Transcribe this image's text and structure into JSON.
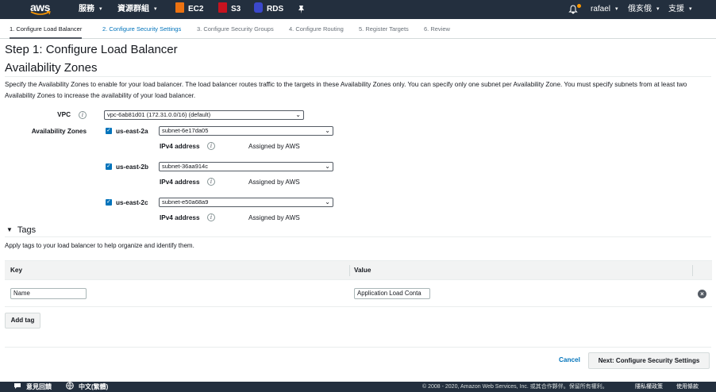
{
  "topnav": {
    "logo_text": "aws",
    "services": "服務",
    "resource_groups": "資源群組",
    "ec2": "EC2",
    "s3": "S3",
    "rds": "RDS",
    "user": "rafael",
    "region": "俄亥俄",
    "support": "支援",
    "caret": "▾",
    "colors": {
      "ec2": "#ec7211",
      "s3": "#c7131f",
      "rds": "#3b48cc",
      "accent": "#ff9900"
    }
  },
  "wizard": {
    "steps": [
      "1. Configure Load Balancer",
      "2. Configure Security Settings",
      "3. Configure Security Groups",
      "4. Configure Routing",
      "5. Register Targets",
      "6. Review"
    ]
  },
  "page": {
    "title": "Step 1: Configure Load Balancer",
    "section": "Availability Zones",
    "description": "Specify the Availability Zones to enable for your load balancer. The load balancer routes traffic to the targets in these Availability Zones only. You can specify only one subnet per Availability Zone. You must specify subnets from at least two Availability Zones to increase the availability of your load balancer."
  },
  "vpc": {
    "label": "VPC",
    "value": "vpc-6ab81d01 (172.31.0.0/16) (default)"
  },
  "az": {
    "label": "Availability Zones",
    "ipv4_label": "IPv4 address",
    "assigned": "Assigned by AWS",
    "zones": [
      {
        "name": "us-east-2a",
        "subnet": "subnet-6e17da05",
        "checked": true
      },
      {
        "name": "us-east-2b",
        "subnet": "subnet-36aa914c",
        "checked": true
      },
      {
        "name": "us-east-2c",
        "subnet": "subnet-e50a68a9",
        "checked": true
      }
    ]
  },
  "tags": {
    "title": "Tags",
    "description": "Apply tags to your load balancer to help organize and identify them.",
    "key_header": "Key",
    "value_header": "Value",
    "rows": [
      {
        "key": "Name",
        "value": "Application Load Conta"
      }
    ],
    "add_label": "Add tag"
  },
  "actions": {
    "cancel": "Cancel",
    "next": "Next: Configure Security Settings"
  },
  "footer": {
    "feedback": "意見回饋",
    "language": "中文(繁體)",
    "copyright": "© 2008 - 2020, Amazon Web Services, Inc. 或其合作夥伴。保留所有權利。",
    "privacy": "隱私權政策",
    "terms": "使用條款"
  }
}
